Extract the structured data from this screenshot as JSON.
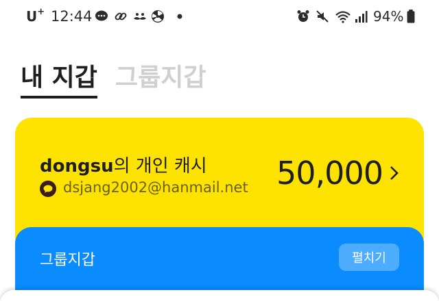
{
  "status_bar": {
    "carrier": "U",
    "carrier_plus": "+",
    "time": "12:44",
    "battery": "94%",
    "icons": [
      "chat-bubble-icon",
      "link-icon",
      "mustache-icon",
      "radiation-icon",
      "dot-icon",
      "alarm-icon",
      "mute-icon",
      "wifi-icon",
      "signal-icon",
      "battery-icon"
    ]
  },
  "tabs": {
    "my_wallet": "내 지갑",
    "group_wallet": "그룹지갑"
  },
  "cash_card": {
    "owner": "dongsu",
    "suffix": "의 개인 캐시",
    "email": "dsjang2002@hanmail.net",
    "amount": "50,000",
    "color": "#ffe300"
  },
  "group_card": {
    "title": "그룹지갑",
    "expand_label": "펼치기",
    "color": "#0a8cff"
  }
}
